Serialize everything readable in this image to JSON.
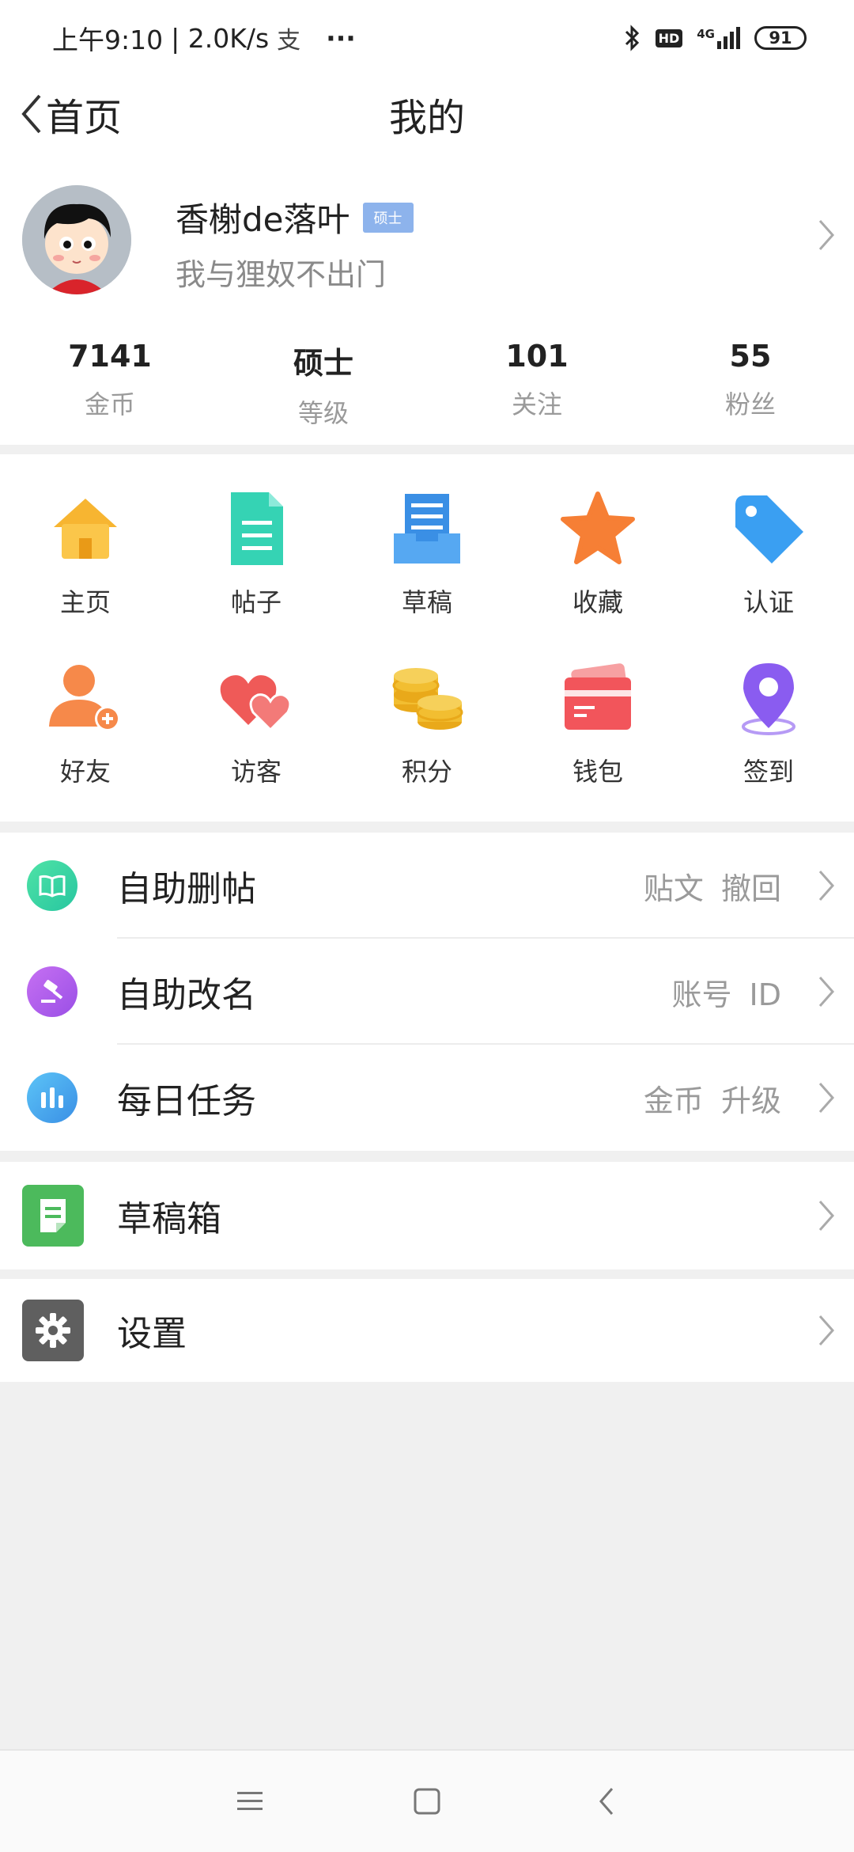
{
  "status_bar": {
    "time": "上午9:10",
    "speed": "| 2.0K/s",
    "app_icon": "alipay-icon",
    "more": "···",
    "network": "4G",
    "battery": "91"
  },
  "nav": {
    "back_label": "首页",
    "title": "我的"
  },
  "profile": {
    "name": "香榭de落叶",
    "badge": "硕士",
    "bio": "我与狸奴不出门",
    "stats": [
      {
        "value": "7141",
        "label": "金币"
      },
      {
        "value": "硕士",
        "label": "等级"
      },
      {
        "value": "101",
        "label": "关注"
      },
      {
        "value": "55",
        "label": "粉丝"
      }
    ]
  },
  "grid": [
    {
      "label": "主页",
      "icon": "home-icon"
    },
    {
      "label": "帖子",
      "icon": "document-icon"
    },
    {
      "label": "草稿",
      "icon": "draft-tray-icon"
    },
    {
      "label": "收藏",
      "icon": "star-icon"
    },
    {
      "label": "认证",
      "icon": "tag-icon"
    },
    {
      "label": "好友",
      "icon": "add-friend-icon"
    },
    {
      "label": "访客",
      "icon": "hearts-icon"
    },
    {
      "label": "积分",
      "icon": "coins-icon"
    },
    {
      "label": "钱包",
      "icon": "wallet-icon"
    },
    {
      "label": "签到",
      "icon": "location-pin-icon"
    }
  ],
  "menu_group1": [
    {
      "label": "自助删帖",
      "hint": "贴文 撤回",
      "icon": "book-icon"
    },
    {
      "label": "自助改名",
      "hint": "账号 ID",
      "icon": "gavel-icon"
    },
    {
      "label": "每日任务",
      "hint": "金币 升级",
      "icon": "bar-chart-icon"
    }
  ],
  "menu_group2": [
    {
      "label": "草稿箱",
      "icon": "draft-box-icon"
    }
  ],
  "menu_group3": [
    {
      "label": "设置",
      "icon": "gear-icon"
    }
  ],
  "colors": {
    "accent_blue": "#8db3ec",
    "home_yellow": "#f7b531",
    "doc_teal": "#35d3b4",
    "draft_blue": "#3a8fe5",
    "star_orange": "#f67f35",
    "tag_blue": "#3a9ff2",
    "friend_orange": "#f6894a",
    "heart_red": "#ef5a58",
    "coin_gold": "#f2be31",
    "wallet_red": "#f2555b",
    "pin_purple": "#8a5cf0"
  }
}
